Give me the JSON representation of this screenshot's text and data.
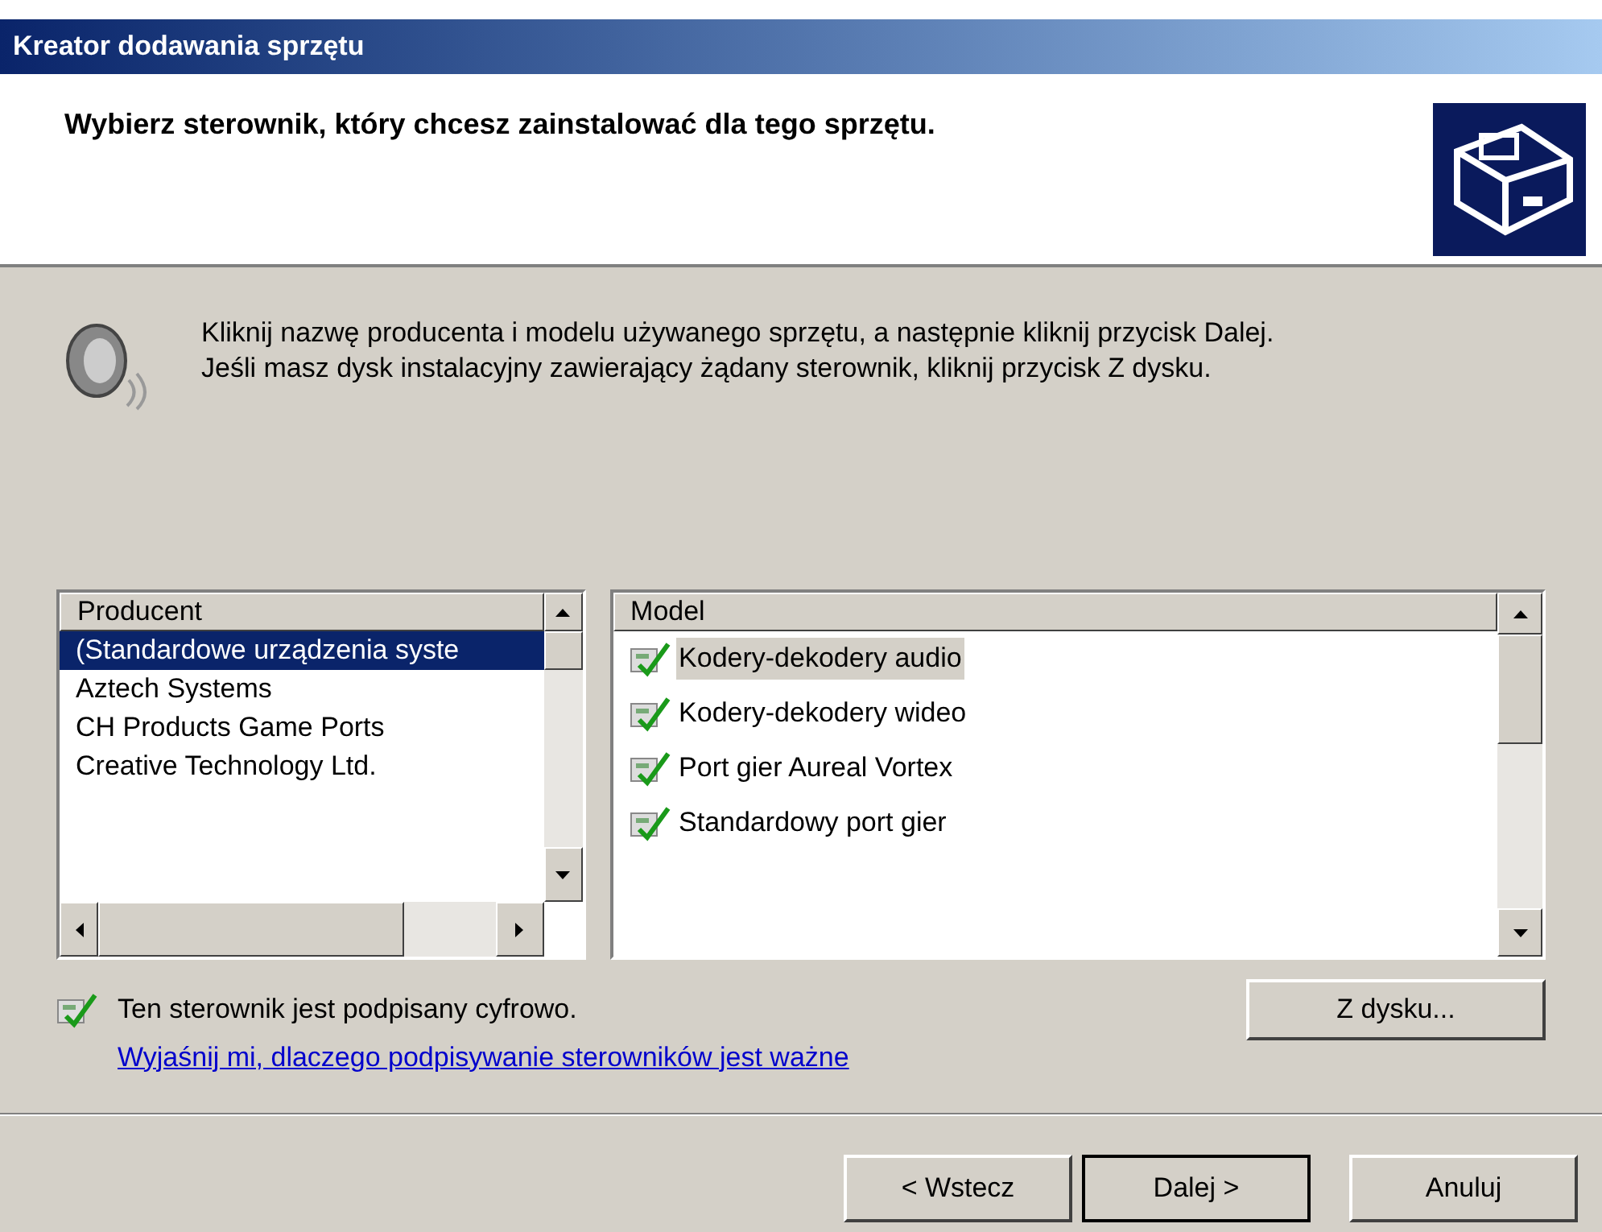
{
  "window": {
    "title": "Kreator dodawania sprzętu"
  },
  "header": {
    "title": "Wybierz sterownik, który chcesz zainstalować dla tego sprzętu."
  },
  "instructions": [
    "Kliknij nazwę producenta i modelu używanego sprzętu, a następnie kliknij przycisk Dalej.",
    "Jeśli masz dysk instalacyjny zawierający żądany sterownik, kliknij przycisk Z dysku."
  ],
  "manufacturers": {
    "column": "Producent",
    "items": [
      {
        "label": "(Standardowe urządzenia syste",
        "selected": true
      },
      {
        "label": "Aztech Systems",
        "selected": false
      },
      {
        "label": "CH Products Game Ports",
        "selected": false
      },
      {
        "label": "Creative Technology Ltd.",
        "selected": false
      }
    ]
  },
  "models": {
    "column": "Model",
    "items": [
      {
        "label": "Kodery-dekodery audio",
        "selected": true
      },
      {
        "label": "Kodery-dekodery wideo",
        "selected": false
      },
      {
        "label": "Port gier Aureal Vortex",
        "selected": false
      },
      {
        "label": "Standardowy port gier",
        "selected": false
      }
    ]
  },
  "signed_note": "Ten sterownik jest podpisany cyfrowo.",
  "help_link": "Wyjaśnij mi, dlaczego podpisywanie sterowników jest ważne",
  "have_disk_button": "Z dysku...",
  "buttons": [
    {
      "label": "< Wstecz",
      "default": false
    },
    {
      "label": "Dalej >",
      "default": true
    },
    {
      "label": "Anuluj",
      "default": false
    }
  ]
}
